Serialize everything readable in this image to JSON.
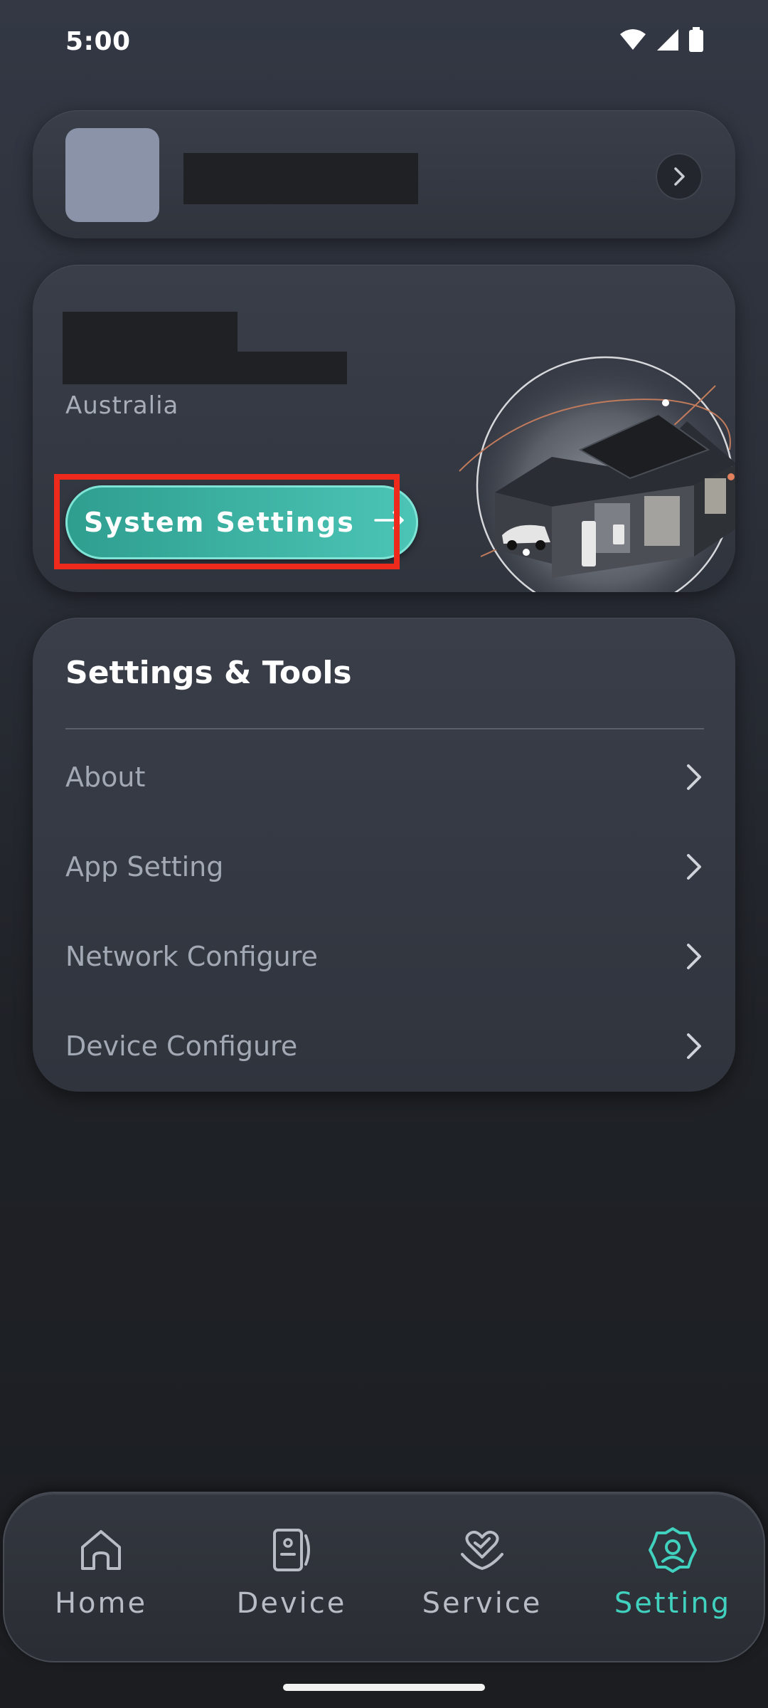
{
  "status_bar": {
    "time": "5:00",
    "icons": [
      "wifi-icon",
      "signal-icon",
      "battery-icon"
    ]
  },
  "site": {
    "country": "Australia",
    "system_settings_label": "System Settings",
    "system_settings_arrow": "→"
  },
  "tools": {
    "title": "Settings & Tools",
    "items": [
      {
        "label": "About"
      },
      {
        "label": "App Setting"
      },
      {
        "label": "Network Configure"
      },
      {
        "label": "Device Configure"
      }
    ]
  },
  "nav": {
    "items": [
      {
        "label": "Home",
        "icon": "home-icon"
      },
      {
        "label": "Device",
        "icon": "device-icon"
      },
      {
        "label": "Service",
        "icon": "service-icon"
      },
      {
        "label": "Setting",
        "icon": "gear-icon"
      }
    ],
    "active": "Setting"
  },
  "colors": {
    "accent": "#40d1bf",
    "highlight_box": "#ee2a1c",
    "muted_text": "#a3a9b4"
  }
}
